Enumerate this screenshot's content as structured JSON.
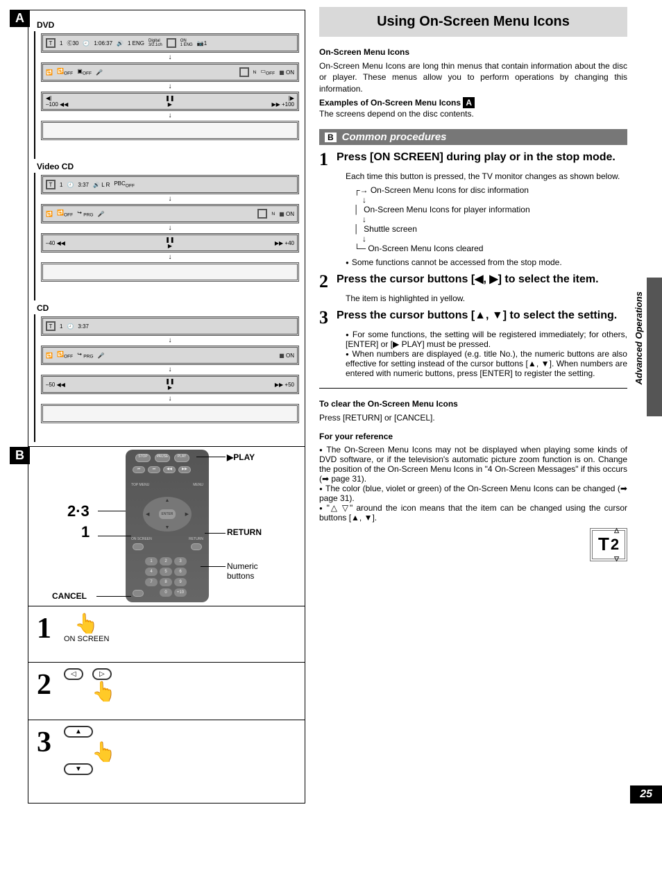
{
  "tags": {
    "A": "A",
    "B": "B"
  },
  "left": {
    "dvd": {
      "label": "DVD",
      "row1": {
        "t": "T",
        "n1": "1",
        "c": "30",
        "time": "1:06:37",
        "aud": "1 ENG",
        "dig": "Digital",
        "ch": "3/2.1ch",
        "on": "ON",
        "eng": "1 ENG",
        "i1": "1"
      },
      "row2": {
        "off1": "OFF",
        "off2": "OFF",
        "n": "N",
        "off3": "OFF",
        "on": "ON"
      },
      "row3": {
        "lneg": "–100",
        "rpos": "+100"
      }
    },
    "vcd": {
      "label": "Video CD",
      "row1": {
        "t": "T",
        "n1": "1",
        "time": "3:37",
        "lr": "L R",
        "pbc": "PBC",
        "off": "OFF"
      },
      "row2": {
        "off1": "OFF",
        "prg": "PRG",
        "n": "N",
        "on": "ON"
      },
      "row3": {
        "lneg": "–40",
        "rpos": "+40"
      }
    },
    "cd": {
      "label": "CD",
      "row1": {
        "t": "T",
        "n1": "1",
        "time": "3:37"
      },
      "row2": {
        "off1": "OFF",
        "prg": "PRG",
        "on": "ON"
      },
      "row3": {
        "lneg": "–50",
        "rpos": "+50"
      }
    },
    "remote": {
      "callout_steps": "2·3",
      "callout_one": "1",
      "play": "▶PLAY",
      "return": "RETURN",
      "numeric": "Numeric buttons",
      "cancel": "CANCEL",
      "enter": "ENTER",
      "btns_top1": "STOP",
      "btns_top2": "PAUSE",
      "btns_top3": "PLAY",
      "btns_mid1": "TOP MENU",
      "btns_mid2": "MENU",
      "btns_bot1": "ON SCREEN",
      "btns_bot2": "RETURN"
    },
    "steps": {
      "s1": {
        "n": "1",
        "label": "ON SCREEN"
      },
      "s2": {
        "n": "2"
      },
      "s3": {
        "n": "3"
      }
    }
  },
  "right": {
    "title": "Using On-Screen Menu Icons",
    "h1": "On-Screen Menu Icons",
    "p1": "On-Screen Menu Icons are long thin menus that contain information about the disc or player. These menus allow you to perform operations by changing this information.",
    "h2a": "Examples of On-Screen Menu Icons",
    "h2b": "The screens depend on the disc contents.",
    "section": "Common procedures",
    "step1": {
      "n": "1",
      "title": "Press [ON SCREEN] during play or in the stop mode.",
      "sub": "Each time this button is pressed, the TV monitor changes as shown below.",
      "flow1": "On-Screen Menu Icons for disc information",
      "flow2": "On-Screen Menu Icons for player information",
      "flow3": "Shuttle screen",
      "flow4": "On-Screen Menu Icons cleared",
      "note": "Some functions cannot be accessed from the stop mode."
    },
    "step2": {
      "n": "2",
      "title": "Press the cursor buttons [◀, ▶] to select the item.",
      "sub": "The item is highlighted in yellow."
    },
    "step3": {
      "n": "3",
      "title": "Press the cursor buttons [▲, ▼] to select the setting.",
      "b1": "For some functions, the setting will be registered immediately; for others, [ENTER] or [▶ PLAY] must be pressed.",
      "b2": "When numbers are displayed (e.g. title No.), the numeric buttons are also effective for setting instead of the cursor buttons [▲, ▼]. When numbers are entered with numeric buttons, press [ENTER] to register the setting."
    },
    "clear_h": "To clear the On-Screen Menu Icons",
    "clear_p": "Press [RETURN] or [CANCEL].",
    "ref_h": "For your reference",
    "ref_b1": "The On-Screen Menu Icons may not be displayed when playing some kinds of DVD software, or if the television's automatic picture zoom function is on. Change the position of the On-Screen Menu Icons in \"4 On-Screen Messages\" if this occurs (➡ page 31).",
    "ref_b2": "The color (blue, violet or green) of the On-Screen Menu Icons can be changed (➡ page 31).",
    "ref_b3": "\"△ ▽\" around the icon means that the item can be changed using the cursor buttons [▲, ▼].",
    "ref_icon_n": "2",
    "side": "Advanced Operations",
    "page": "25"
  }
}
